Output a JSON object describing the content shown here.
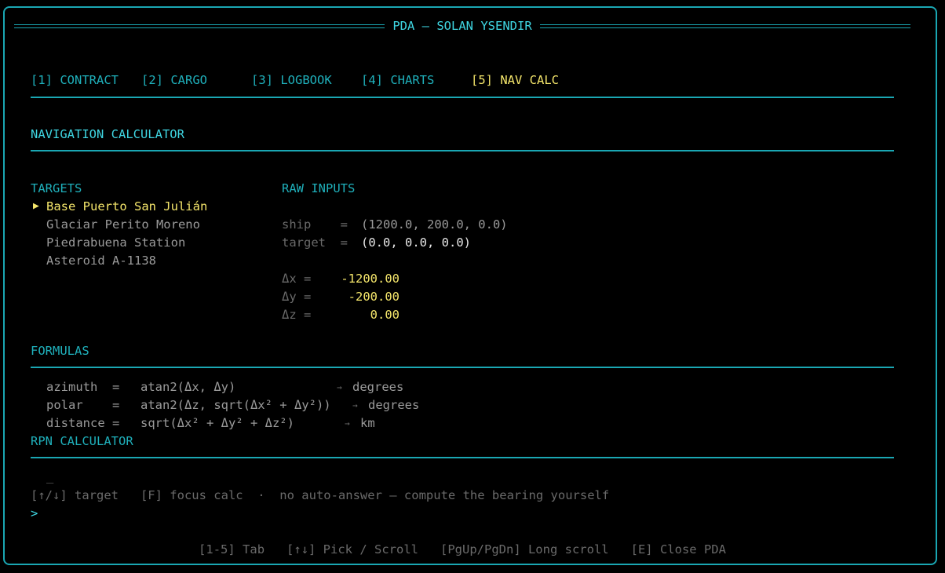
{
  "window": {
    "title": "PDA — SOLAN YSENDIR"
  },
  "tabs": [
    {
      "label": "[1] CONTRACT",
      "active": false
    },
    {
      "label": "[2] CARGO",
      "active": false
    },
    {
      "label": "[3] LOGBOOK",
      "active": false
    },
    {
      "label": "[4] CHARTS",
      "active": false
    },
    {
      "label": "[5] NAV CALC",
      "active": true
    }
  ],
  "section_title": "NAVIGATION CALCULATOR",
  "targets": {
    "header": "TARGETS",
    "cursor": "▶",
    "items": [
      "Base Puerto San Julián",
      "Glaciar Perito Moreno",
      "Piedrabuena Station",
      "Asteroid A-1138"
    ],
    "selected_index": 0
  },
  "raw_inputs": {
    "header": "RAW INPUTS",
    "ship_label": "ship    =",
    "ship_value": "(1200.0, 200.0, 0.0)",
    "target_label": "target  =",
    "target_value": "(0.0, 0.0, 0.0)",
    "dx_label": "Δx =",
    "dx_value": "-1200.00",
    "dy_label": "Δy =",
    "dy_value": "-200.00",
    "dz_label": "Δz =",
    "dz_value": "0.00"
  },
  "formulas": {
    "header": "FORMULAS",
    "lines": [
      {
        "lhs": "azimuth  =",
        "expr": "atan2(Δx, Δy)",
        "arrow": "→",
        "unit": "degrees"
      },
      {
        "lhs": "polar    =",
        "expr": "atan2(Δz, sqrt(Δx² + Δy²))",
        "arrow": "→",
        "unit": "degrees"
      },
      {
        "lhs": "distance =",
        "expr": "sqrt(Δx² + Δy² + Δz²)",
        "arrow": "→",
        "unit": "km"
      }
    ]
  },
  "rpn": {
    "header": "RPN CALCULATOR",
    "cursor": "_",
    "hint": "[↑/↓] target   [F] focus calc  ·  no auto-answer — compute the bearing yourself",
    "prompt": ">"
  },
  "footer": {
    "text": "[1-5] Tab   [↑↓] Pick / Scroll   [PgUp/PgDn] Long scroll   [E] Close PDA"
  },
  "colors": {
    "accent": "#1aa7b3",
    "highlight": "#f5e66b",
    "background": "#000000"
  }
}
